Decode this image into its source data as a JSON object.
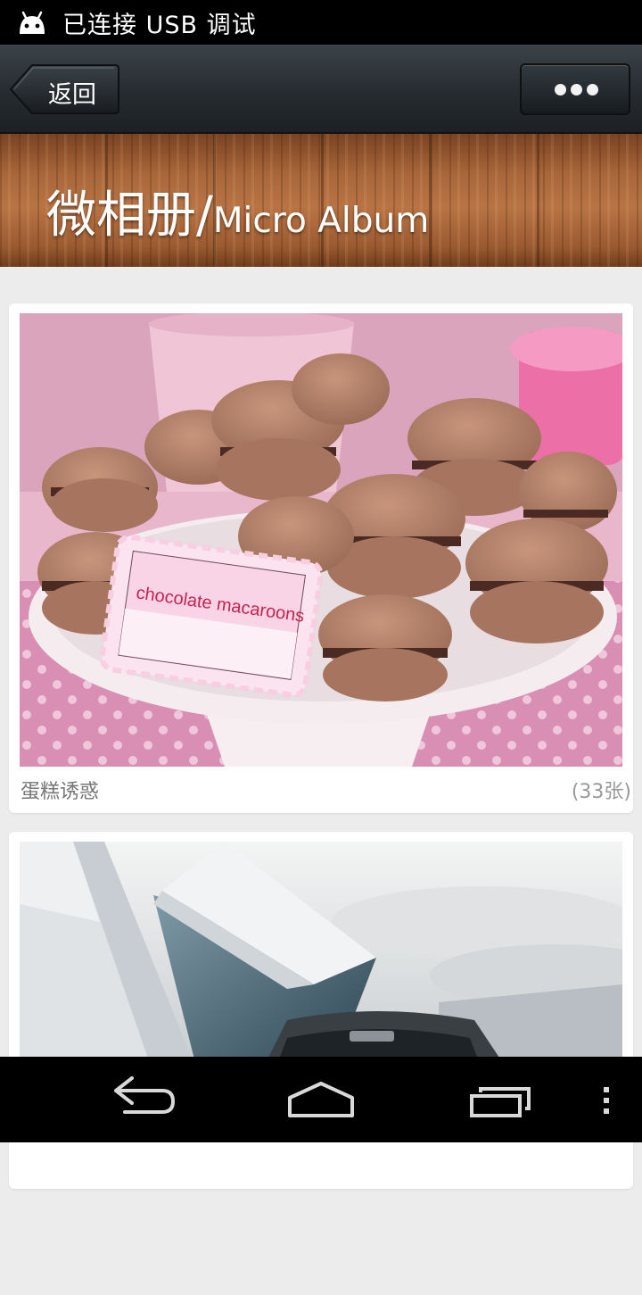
{
  "status_bar": {
    "text": "已连接 USB 调试",
    "icon": "android-icon"
  },
  "nav_bar": {
    "back_label": "返回",
    "more_icon": "more-dots-icon"
  },
  "header": {
    "title_cn": "微相册/",
    "title_en": "Micro Album"
  },
  "albums": [
    {
      "name": "蛋糕诱惑",
      "count": "(33张)",
      "photo_label": "chocolate macaroons"
    },
    {
      "name": "",
      "count": ""
    }
  ],
  "bottom_nav": {
    "back_icon": "back-arrow-icon",
    "home_icon": "home-icon",
    "recents_icon": "recent-apps-icon",
    "menu_icon": "overflow-menu-icon"
  }
}
